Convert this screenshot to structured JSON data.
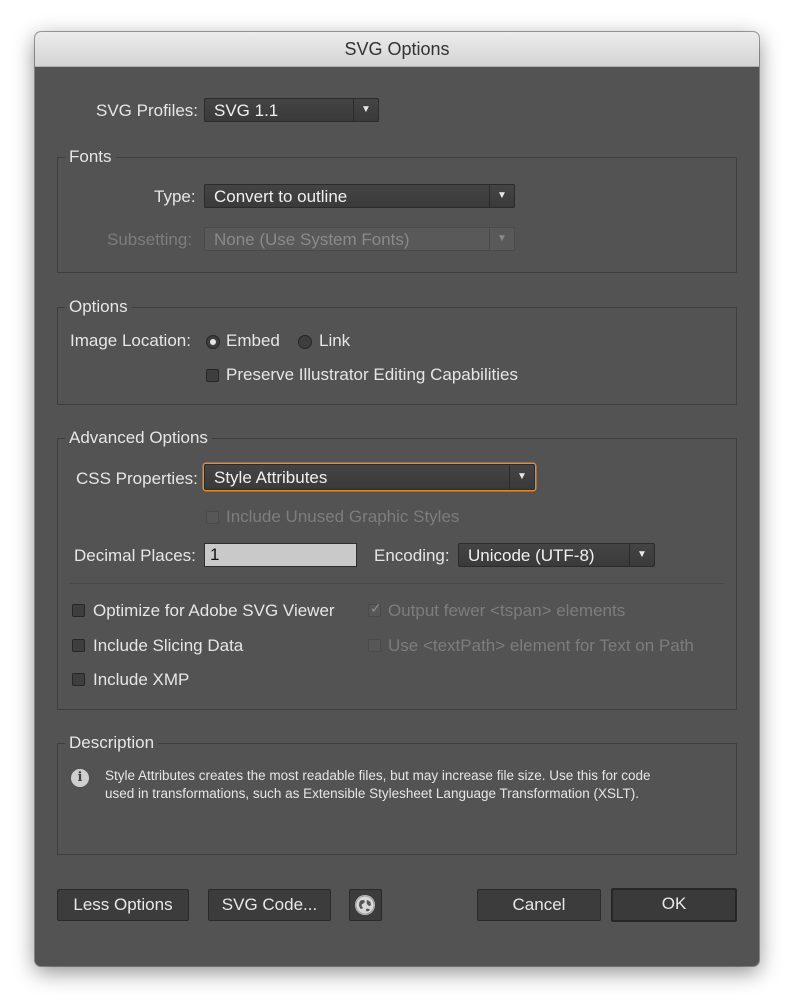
{
  "window": {
    "title": "SVG Options"
  },
  "profiles": {
    "label": "SVG Profiles:",
    "value": "SVG 1.1"
  },
  "fonts": {
    "legend": "Fonts",
    "type_label": "Type:",
    "type_value": "Convert to outline",
    "subsetting_label": "Subsetting:",
    "subsetting_value": "None (Use System Fonts)"
  },
  "options": {
    "legend": "Options",
    "image_location_label": "Image Location:",
    "embed_label": "Embed",
    "link_label": "Link",
    "selected": "Embed",
    "preserve_label": "Preserve Illustrator Editing Capabilities",
    "preserve_checked": false
  },
  "advanced": {
    "legend": "Advanced Options",
    "css_label": "CSS Properties:",
    "css_value": "Style Attributes",
    "unused_styles_label": "Include Unused Graphic Styles",
    "decimal_label": "Decimal Places:",
    "decimal_value": "1",
    "encoding_label": "Encoding:",
    "encoding_value": "Unicode (UTF-8)",
    "optimize_label": "Optimize for Adobe SVG Viewer",
    "slicing_label": "Include Slicing Data",
    "xmp_label": "Include XMP",
    "tspan_label": "Output fewer <tspan> elements",
    "textpath_label": "Use <textPath> element for Text on Path"
  },
  "description": {
    "legend": "Description",
    "line1": "Style Attributes creates the most readable files, but may increase file size. Use this for code",
    "line2": "used in transformations, such as Extensible Stylesheet Language Transformation (XSLT)."
  },
  "buttons": {
    "less": "Less Options",
    "svg_code": "SVG Code...",
    "cancel": "Cancel",
    "ok": "OK"
  },
  "icons": {
    "arrow": "▼",
    "check": "✓",
    "info": "i"
  },
  "colors": {
    "dialog_bg": "#535353",
    "focus_ring": "#e58a2f"
  }
}
